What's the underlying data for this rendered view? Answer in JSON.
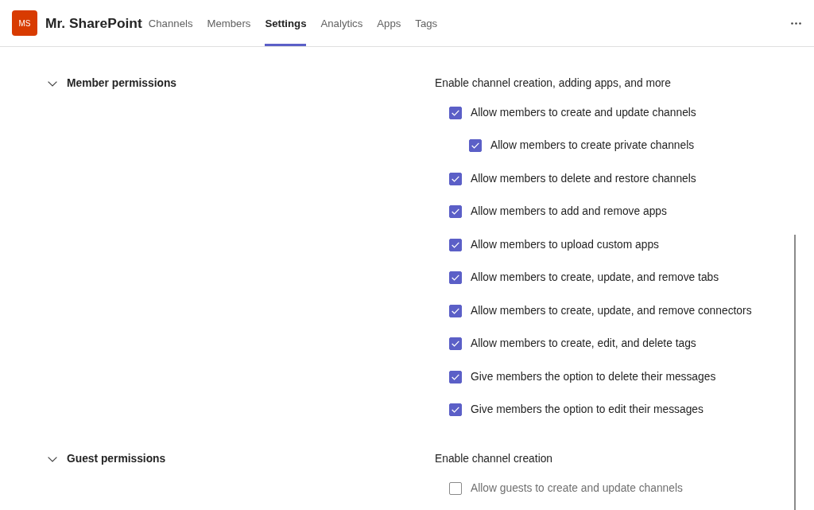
{
  "header": {
    "team": {
      "initials": "MS",
      "name": "Mr. SharePoint"
    },
    "tabs": [
      {
        "label": "Channels",
        "selected": false
      },
      {
        "label": "Members",
        "selected": false
      },
      {
        "label": "Settings",
        "selected": true
      },
      {
        "label": "Analytics",
        "selected": false
      },
      {
        "label": "Apps",
        "selected": false
      },
      {
        "label": "Tags",
        "selected": false
      }
    ]
  },
  "sections": [
    {
      "title": "Member permissions",
      "expanded": true,
      "description": "Enable channel creation, adding apps, and more",
      "options": [
        {
          "label": "Allow members to create and update channels",
          "checked": true,
          "disabled": false,
          "children": [
            {
              "label": "Allow members to create private channels",
              "checked": true,
              "disabled": false
            }
          ]
        },
        {
          "label": "Allow members to delete and restore channels",
          "checked": true,
          "disabled": false
        },
        {
          "label": "Allow members to add and remove apps",
          "checked": true,
          "disabled": false
        },
        {
          "label": "Allow members to upload custom apps",
          "checked": true,
          "disabled": false
        },
        {
          "label": "Allow members to create, update, and remove tabs",
          "checked": true,
          "disabled": false
        },
        {
          "label": "Allow members to create, update, and remove connectors",
          "checked": true,
          "disabled": false
        },
        {
          "label": "Allow members to create, edit, and delete tags",
          "checked": true,
          "disabled": false
        },
        {
          "label": "Give members the option to delete their messages",
          "checked": true,
          "disabled": false
        },
        {
          "label": "Give members the option to edit their messages",
          "checked": true,
          "disabled": false
        }
      ]
    },
    {
      "title": "Guest permissions",
      "expanded": true,
      "description": "Enable channel creation",
      "options": [
        {
          "label": "Allow guests to create and update channels",
          "checked": false,
          "disabled": true
        }
      ]
    }
  ]
}
